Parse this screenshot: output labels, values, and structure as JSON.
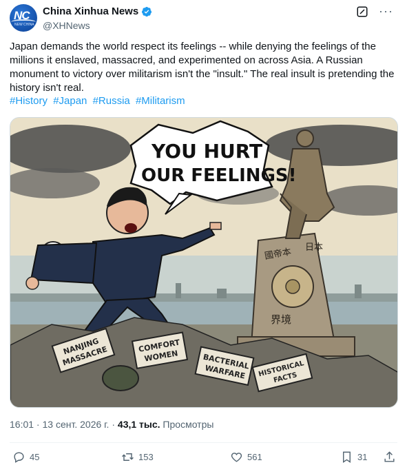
{
  "author": {
    "display_name": "China Xinhua News",
    "handle": "@XHNews",
    "avatar_text": "NC",
    "avatar_subtext": "NEW CHINA"
  },
  "tweet": {
    "text": "Japan demands the world respect its feelings -- while denying the feelings of the millions it enslaved, massacred, and experimented on across Asia. A Russian monument to victory over militarism isn't the \"insult.\" The real insult is pretending the history isn't real.",
    "hashtags": [
      "#History",
      "#Japan",
      "#Russia",
      "#Militarism"
    ]
  },
  "image": {
    "speech_bubble_line1": "YOU HURT",
    "speech_bubble_line2": "OUR FEELINGS!",
    "rubble_signs": [
      {
        "line1": "NANJING",
        "line2": "MASSACRE"
      },
      {
        "line1": "COMFORT",
        "line2": "WOMEN"
      },
      {
        "line1": "BACTERIAL",
        "line2": "WARFARE"
      },
      {
        "line1": "HISTORICAL",
        "line2": "FACTS"
      }
    ],
    "monument_chars_left": "國帝本",
    "monument_chars_right": "日本",
    "monument_chars_bottom": "界境"
  },
  "meta": {
    "time": "16:01",
    "separator": " · ",
    "date": "13 сент. 2026 г.",
    "views_count": "43,1 тыс.",
    "views_label": " Просмотры"
  },
  "actions": {
    "replies": "45",
    "reposts": "153",
    "likes": "561",
    "bookmarks": "31"
  },
  "colors": {
    "accent": "#1d9bf0",
    "muted": "#536471"
  }
}
